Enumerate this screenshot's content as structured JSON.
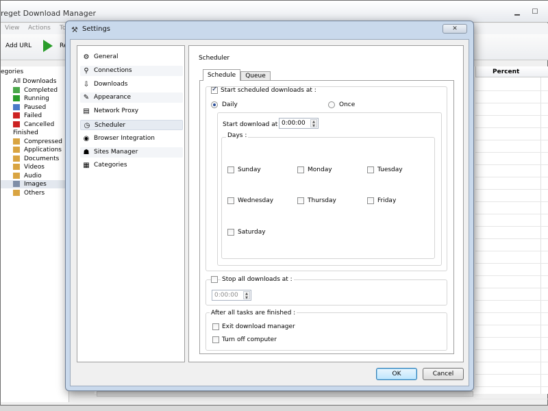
{
  "main_window": {
    "title": "reget Download Manager",
    "menu": [
      "View",
      "Actions",
      "To"
    ],
    "toolbar": {
      "add_url": "Add URL",
      "resume_partial": "Re"
    },
    "categories_header": "egories",
    "tree": [
      {
        "label": "All Downloads",
        "icon": "folder-icon",
        "indent": 0
      },
      {
        "label": "Completed",
        "icon": "check-icon",
        "indent": 1
      },
      {
        "label": "Running",
        "icon": "play-icon",
        "indent": 1
      },
      {
        "label": "Paused",
        "icon": "pause-icon",
        "indent": 1
      },
      {
        "label": "Failed",
        "icon": "error-icon",
        "indent": 1
      },
      {
        "label": "Cancelled",
        "icon": "cancel-icon",
        "indent": 1
      },
      {
        "label": "Finished",
        "icon": "folder-icon",
        "indent": 0
      },
      {
        "label": "Compressed",
        "icon": "archive-icon",
        "indent": 1
      },
      {
        "label": "Applications",
        "icon": "app-icon",
        "indent": 1
      },
      {
        "label": "Documents",
        "icon": "document-icon",
        "indent": 1
      },
      {
        "label": "Videos",
        "icon": "video-icon",
        "indent": 1
      },
      {
        "label": "Audio",
        "icon": "audio-icon",
        "indent": 1
      },
      {
        "label": "Images",
        "icon": "image-icon",
        "indent": 1
      },
      {
        "label": "Others",
        "icon": "folder-icon",
        "indent": 1
      }
    ],
    "grid_header_percent": "Percent"
  },
  "dialog": {
    "title": "Settings",
    "close_glyph": "✕",
    "nav": [
      {
        "label": "General",
        "icon": "general-icon"
      },
      {
        "label": "Connections",
        "icon": "connections-icon"
      },
      {
        "label": "Downloads",
        "icon": "downloads-icon"
      },
      {
        "label": "Appearance",
        "icon": "appearance-icon"
      },
      {
        "label": "Network Proxy",
        "icon": "network-proxy-icon"
      },
      {
        "label": "Scheduler",
        "icon": "scheduler-icon"
      },
      {
        "label": "Browser Integration",
        "icon": "browser-integration-icon"
      },
      {
        "label": "Sites Manager",
        "icon": "sites-manager-icon"
      },
      {
        "label": "Categories",
        "icon": "categories-icon"
      }
    ],
    "selected_nav": "Scheduler",
    "section_title": "Scheduler",
    "tabs": {
      "schedule": "Schedule",
      "queue": "Queue"
    },
    "start_scheduled": {
      "label": "Start scheduled downloads at :",
      "checked": true
    },
    "mode": {
      "daily": "Daily",
      "once": "Once",
      "selected": "Daily"
    },
    "start_download_at": {
      "label": "Start download at :",
      "value": "0:00:00"
    },
    "days_label": "Days :",
    "days": [
      "Sunday",
      "Monday",
      "Tuesday",
      "Wednesday",
      "Thursday",
      "Friday",
      "Saturday"
    ],
    "stop_all": {
      "label": "Stop all downloads at :",
      "checked": false,
      "value": "0:00:00"
    },
    "after_finished": {
      "label": "After all tasks are finished :",
      "exit_label": "Exit download manager",
      "turnoff_label": "Turn off computer"
    },
    "ok_label": "OK",
    "cancel_label": "Cancel"
  }
}
